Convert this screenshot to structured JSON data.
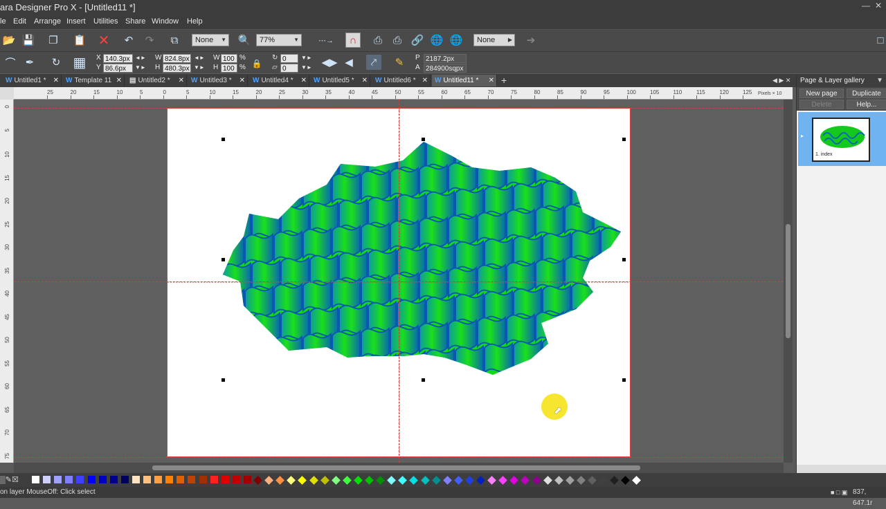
{
  "app": {
    "title": "ara Designer Pro X - [Untitled11 *]",
    "window_controls": [
      "—",
      "□",
      "✕"
    ]
  },
  "menu": [
    "le",
    "Edit",
    "Arrange",
    "Insert",
    "Utilities",
    "Share",
    "Window",
    "Help"
  ],
  "toolbar1": {
    "quality_dropdown": "None",
    "zoom_dropdown": "77%",
    "feather_dropdown": "None"
  },
  "toolbar2": {
    "x_label": "X",
    "x_value": "140.3px",
    "y_label": "Y",
    "y_value": "86.6px",
    "w_label": "W",
    "w_value": "824.8px",
    "h_label": "H",
    "h_value": "480.3px",
    "scale_w_label": "W",
    "scale_w_value": "100",
    "scale_h_label": "H",
    "scale_h_value": "100",
    "percent": "%",
    "rotate_value": "0",
    "skew_value": "0",
    "p_label": "P",
    "perimeter_value": "2187.2px",
    "a_label": "A",
    "area_value": "284900sqpx"
  },
  "tabs": [
    {
      "label": "Untitled1 *",
      "icon": "W"
    },
    {
      "label": "Template 11",
      "icon": "W"
    },
    {
      "label": "Untitled2 *",
      "icon": "doc"
    },
    {
      "label": "Untitled3 *",
      "icon": "W"
    },
    {
      "label": "Untitled4 *",
      "icon": "W"
    },
    {
      "label": "Untitled5 *",
      "icon": "W"
    },
    {
      "label": "Untitled6 *",
      "icon": "W"
    },
    {
      "label": "Untitled11 *",
      "icon": "W",
      "active": true
    }
  ],
  "ruler": {
    "h_ticks": [
      "25",
      "20",
      "15",
      "10",
      "5",
      "0",
      "5",
      "10",
      "15",
      "20",
      "25",
      "30",
      "35",
      "40",
      "45",
      "50",
      "55",
      "60",
      "65",
      "70",
      "75",
      "80",
      "85",
      "90",
      "95",
      "100",
      "105",
      "110",
      "115",
      "120",
      "125"
    ],
    "h_units": "Pixels × 10",
    "v_ticks": [
      "0",
      "5",
      "10",
      "15",
      "20",
      "25",
      "30",
      "35",
      "40",
      "45",
      "50",
      "55",
      "60",
      "65",
      "70",
      "75"
    ]
  },
  "gallery": {
    "title": "Page & Layer gallery",
    "new_page": "New page",
    "duplicate": "Duplicate",
    "delete": "Delete",
    "help": "Help...",
    "page_label": "1. index"
  },
  "palette_colors": [
    "#ffffff",
    "#d0d0ff",
    "#a0a0ff",
    "#8080ff",
    "#4040ff",
    "#0000ff",
    "#0000c0",
    "#000090",
    "#000060",
    "#ffe4c4",
    "#ffc080",
    "#ffa040",
    "#ff8000",
    "#e06000",
    "#c04000",
    "#a03000",
    "#ff2020",
    "#e00000",
    "#c00000",
    "#a00000",
    "#800000",
    "#ffb080",
    "#ff9040",
    "#ffff80",
    "#ffff00",
    "#e0e000",
    "#c0c000",
    "#80ff80",
    "#40ff40",
    "#00e000",
    "#00c000",
    "#009000",
    "#80ffff",
    "#40ffff",
    "#00e0e0",
    "#00c0c0",
    "#009090",
    "#8080ff",
    "#4060ff",
    "#2040e0",
    "#0020c0",
    "#ff80ff",
    "#ff40ff",
    "#e000e0",
    "#c000c0",
    "#900090",
    "#e0e0e0",
    "#c0c0c0",
    "#a0a0a0",
    "#808080",
    "#606060",
    "#404040",
    "#202020",
    "#000000",
    "#ffffff"
  ],
  "status": {
    "message": "on layer MouseOff: Click select",
    "coords": "837, 647.1r"
  }
}
